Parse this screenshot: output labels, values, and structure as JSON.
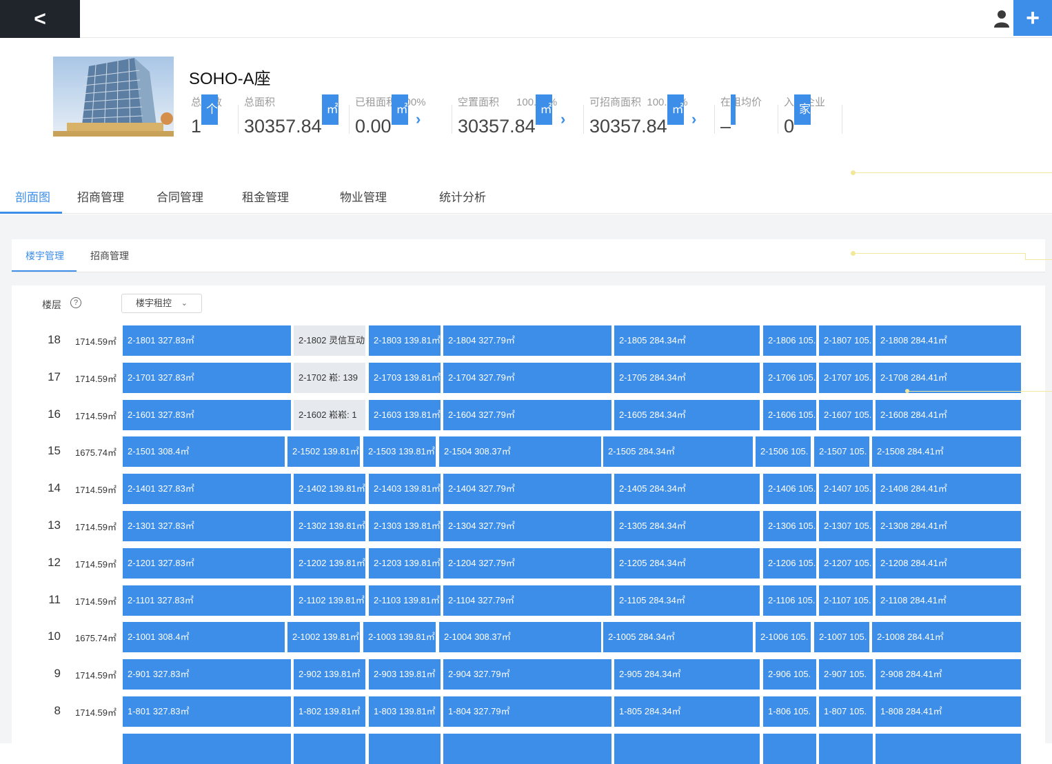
{
  "topbar": {
    "back_label": "<",
    "add_label": "+"
  },
  "building": {
    "title": "SOHO-A座",
    "stats": [
      {
        "label": "总楼数",
        "value": "1",
        "unit": "个"
      },
      {
        "label": "总面积",
        "value": "30357.84",
        "unit": "㎡"
      },
      {
        "label": "已租面积0.00%",
        "value": "0.00",
        "unit": "㎡"
      },
      {
        "label": "空置面积",
        "pct": "100.00%",
        "value": "30357.84",
        "unit": "㎡"
      },
      {
        "label": "可招商面积",
        "pct": "100.00%",
        "value": "30357.84",
        "unit": "㎡"
      },
      {
        "label": "在租均价",
        "value": "–",
        "unit": ""
      },
      {
        "label": "入驻企业",
        "value": "0",
        "unit": "家"
      }
    ]
  },
  "main_tabs": [
    "剖面图",
    "招商管理",
    "合同管理",
    "租金管理",
    "物业管理",
    "统计分析"
  ],
  "sub_tabs": [
    "楼宇管理",
    "招商管理"
  ],
  "filter": {
    "floor_label": "楼层",
    "help": "?",
    "select_value": "楼宇租控"
  },
  "floors": [
    {
      "num": "18",
      "area": "1714.59㎡",
      "units": [
        "2-1801 327.83㎡",
        "2-1802 灵信互动",
        "2-1803 139.81㎡",
        "2-1804 327.79㎡",
        "2-1805 284.34㎡",
        "2-1806 105.",
        "2-1807 105.",
        "2-1808 284.41㎡"
      ]
    },
    {
      "num": "17",
      "area": "1714.59㎡",
      "units": [
        "2-1701 327.83㎡",
        "2-1702 崧: 139",
        "2-1703 139.81㎡",
        "2-1704 327.79㎡",
        "2-1705 284.34㎡",
        "2-1706 105.",
        "2-1707 105.",
        "2-1708 284.41㎡"
      ]
    },
    {
      "num": "16",
      "area": "1714.59㎡",
      "units": [
        "2-1601 327.83㎡",
        "2-1602 崧崧: 1",
        "2-1603 139.81㎡",
        "2-1604 327.79㎡",
        "2-1605 284.34㎡",
        "2-1606 105.",
        "2-1607 105.",
        "2-1608 284.41㎡"
      ]
    },
    {
      "num": "15",
      "area": "1675.74㎡",
      "units": [
        "2-1501 308.4㎡",
        "2-1502 139.81㎡",
        "2-1503 139.81㎡",
        "2-1504 308.37㎡",
        "2-1505 284.34㎡",
        "2-1506 105.",
        "2-1507 105.",
        "2-1508 284.41㎡"
      ]
    },
    {
      "num": "14",
      "area": "1714.59㎡",
      "units": [
        "2-1401 327.83㎡",
        "2-1402 139.81㎡",
        "2-1403 139.81㎡",
        "2-1404 327.79㎡",
        "2-1405 284.34㎡",
        "2-1406 105.",
        "2-1407 105.",
        "2-1408 284.41㎡"
      ]
    },
    {
      "num": "13",
      "area": "1714.59㎡",
      "units": [
        "2-1301 327.83㎡",
        "2-1302 139.81㎡",
        "2-1303 139.81㎡",
        "2-1304 327.79㎡",
        "2-1305 284.34㎡",
        "2-1306 105.",
        "2-1307 105.",
        "2-1308 284.41㎡"
      ]
    },
    {
      "num": "12",
      "area": "1714.59㎡",
      "units": [
        "2-1201 327.83㎡",
        "2-1202 139.81㎡",
        "2-1203 139.81㎡",
        "2-1204 327.79㎡",
        "2-1205 284.34㎡",
        "2-1206 105.",
        "2-1207 105.",
        "2-1208 284.41㎡"
      ]
    },
    {
      "num": "11",
      "area": "1714.59㎡",
      "units": [
        "2-1101 327.83㎡",
        "2-1102 139.81㎡",
        "2-1103 139.81㎡",
        "2-1104 327.79㎡",
        "2-1105 284.34㎡",
        "2-1106 105.",
        "2-1107 105.",
        "2-1108 284.41㎡"
      ]
    },
    {
      "num": "10",
      "area": "1675.74㎡",
      "units": [
        "2-1001 308.4㎡",
        "2-1002 139.81㎡",
        "2-1003 139.81㎡",
        "2-1004 308.37㎡",
        "2-1005 284.34㎡",
        "2-1006 105.",
        "2-1007 105.",
        "2-1008 284.41㎡"
      ]
    },
    {
      "num": "9",
      "area": "1714.59㎡",
      "units": [
        "2-901 327.83㎡",
        "2-902 139.81㎡",
        "2-903 139.81㎡",
        "2-904 327.79㎡",
        "2-905 284.34㎡",
        "2-906 105.",
        "2-907 105.",
        "2-908 284.41㎡"
      ]
    },
    {
      "num": "8",
      "area": "1714.59㎡",
      "units": [
        "1-801 327.83㎡",
        "1-802 139.81㎡",
        "1-803 139.81㎡",
        "1-804 327.79㎡",
        "1-805 284.34㎡",
        "1-806 105.",
        "1-807 105.",
        "1-808 284.41㎡"
      ]
    }
  ],
  "colors": {
    "accent": "#3d8ee8",
    "vacant": "#e6e9ee",
    "topbar_dark": "#1f252b"
  },
  "icons": {
    "user": "user-icon",
    "add": "plus-icon",
    "help": "question-circle-icon",
    "arrow": "chevron-right-icon"
  }
}
